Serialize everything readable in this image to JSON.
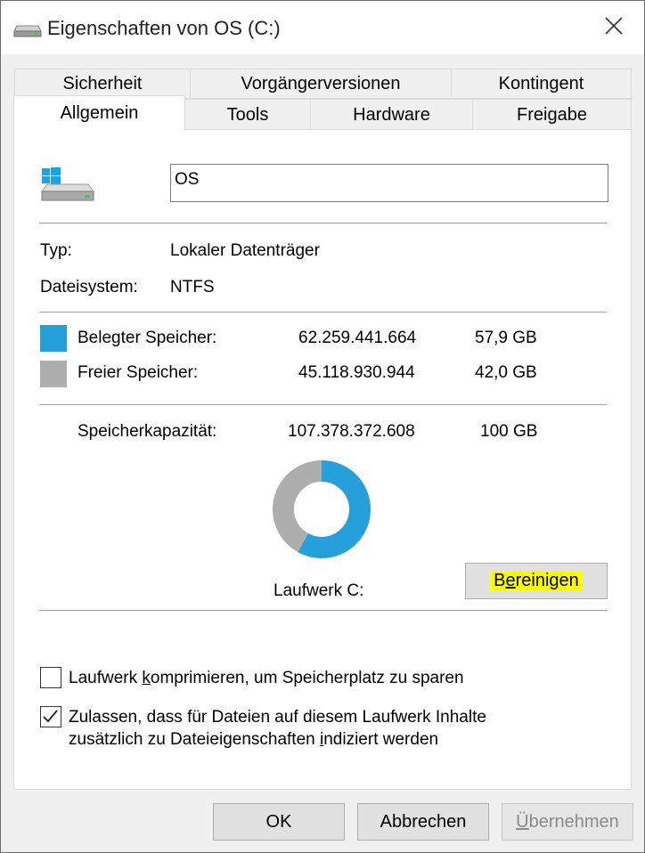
{
  "window": {
    "title": "Eigenschaften von OS (C:)",
    "title_icon": "drive-icon"
  },
  "tabs": {
    "row_back": [
      {
        "label": "Sicherheit"
      },
      {
        "label": "Vorgängerversionen"
      },
      {
        "label": "Kontingent"
      }
    ],
    "row_front": [
      {
        "label": "Allgemein",
        "active": true
      },
      {
        "label": "Tools"
      },
      {
        "label": "Hardware"
      },
      {
        "label": "Freigabe"
      }
    ]
  },
  "general": {
    "drive_icon": "windows-drive-icon",
    "name_value": "OS",
    "type_label": "Typ:",
    "type_value": "Lokaler Datenträger",
    "fs_label": "Dateisystem:",
    "fs_value": "NTFS",
    "used": {
      "label": "Belegter Speicher:",
      "bytes": "62.259.441.664",
      "size": "57,9 GB",
      "color": "#26a0da"
    },
    "free": {
      "label": "Freier Speicher:",
      "bytes": "45.118.930.944",
      "size": "42,0 GB",
      "color": "#aeaeae"
    },
    "capacity": {
      "label": "Speicherkapazität:",
      "bytes": "107.378.372.608",
      "size": "100 GB"
    },
    "used_fraction": 0.579,
    "drive_label": "Laufwerk C:",
    "cleanup": {
      "pre": "B",
      "mid": "e",
      "post": "reinigen",
      "highlight_color": "#ffff00"
    },
    "compress": {
      "pre": "Laufwerk ",
      "ul": "k",
      "post": "omprimieren, um Speicherplatz zu sparen",
      "checked": false
    },
    "index": {
      "line1": "Zulassen, dass für Dateien auf diesem Laufwerk Inhalte",
      "line2_pre": "zusätzlich zu Dateieigenschaften ",
      "line2_ul": "i",
      "line2_post": "ndiziert werden",
      "checked": true
    }
  },
  "buttons": {
    "ok": "OK",
    "cancel": "Abbrechen",
    "apply_ul": "Ü",
    "apply_rest": "bernehmen",
    "apply_disabled": true
  }
}
